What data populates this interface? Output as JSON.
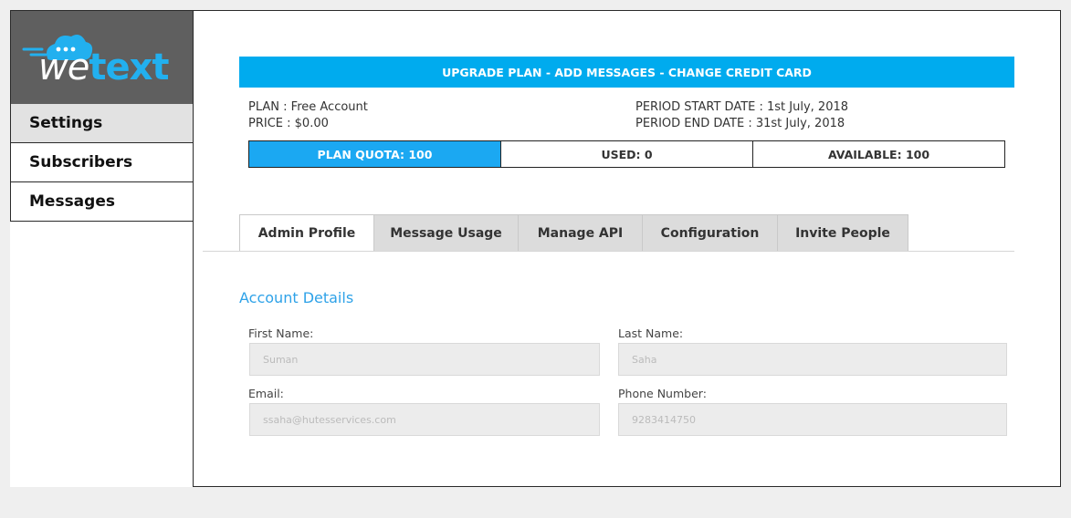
{
  "sidebar": {
    "logo_text": "wetext",
    "items": [
      {
        "label": "Settings"
      },
      {
        "label": "Subscribers"
      },
      {
        "label": "Messages"
      }
    ]
  },
  "banner": {
    "label": "UPGRADE PLAN - ADD MESSAGES - CHANGE CREDIT CARD"
  },
  "plan": {
    "plan_label": "PLAN :",
    "plan_value": "Free Account",
    "price_label": "PRICE :",
    "price_value": "$0.00",
    "start_label": "PERIOD START DATE :",
    "start_value": "1st July, 2018",
    "end_label": "PERIOD END DATE :",
    "end_value": "31st July, 2018"
  },
  "quota": {
    "plan_quota": "PLAN QUOTA: 100",
    "used": "USED: 0",
    "available": "AVAILABLE: 100"
  },
  "tabs": [
    {
      "label": "Admin Profile"
    },
    {
      "label": "Message Usage"
    },
    {
      "label": "Manage API"
    },
    {
      "label": "Configuration"
    },
    {
      "label": "Invite People"
    }
  ],
  "account": {
    "title": "Account Details",
    "first_name_label": "First Name:",
    "first_name_value": "Suman",
    "last_name_label": "Last Name:",
    "last_name_value": "Saha",
    "email_label": "Email:",
    "email_value": "ssaha@hutesservices.com",
    "phone_label": "Phone Number:",
    "phone_value": "9283414750"
  },
  "colors": {
    "accent": "#00abee",
    "quota_highlight": "#1ba8f2",
    "section_title": "#2ea2e8",
    "logo_bg": "#5f5f5f"
  }
}
